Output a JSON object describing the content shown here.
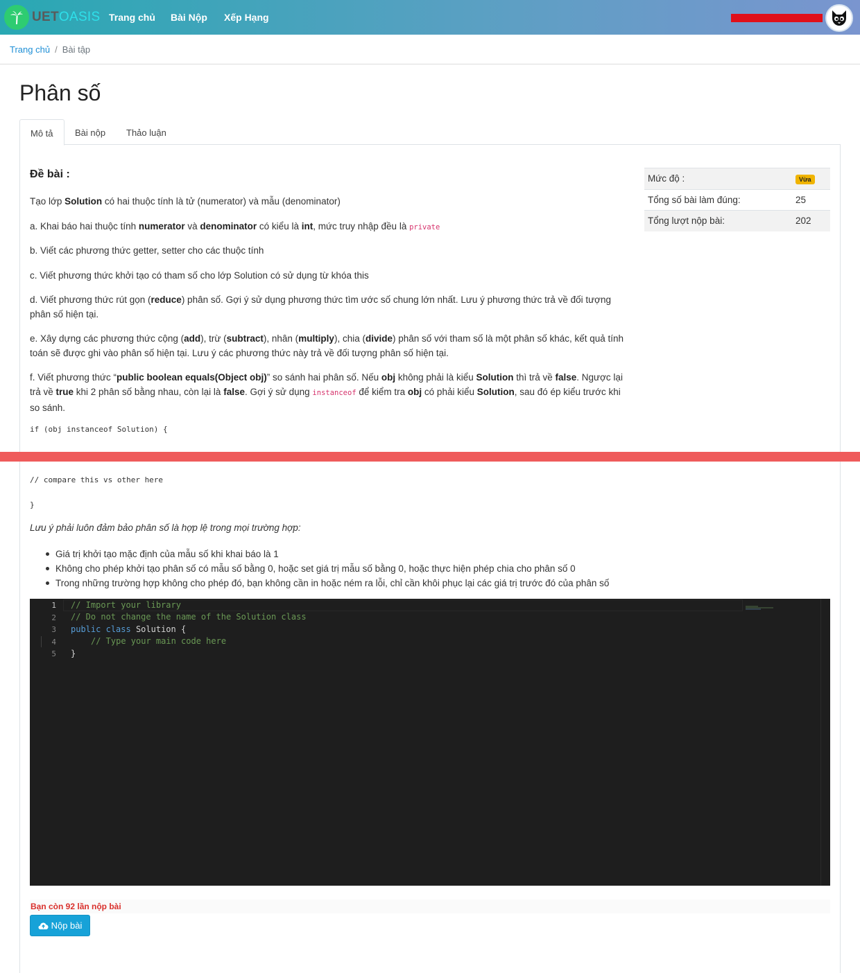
{
  "nav": {
    "logo_uet": "UET",
    "logo_oasis": "OASIS",
    "links": [
      "Trang chủ",
      "Bài Nộp",
      "Xếp Hạng"
    ]
  },
  "breadcrumb": {
    "home": "Trang chủ",
    "current": "Bài tập"
  },
  "title": "Phân số",
  "tabs": [
    "Mô tả",
    "Bài nộp",
    "Thảo luận"
  ],
  "problem": {
    "heading": "Đề bài :",
    "intro": [
      "Tạo lớp ",
      "Solution",
      " có hai thuộc tính là tử (numerator) và mẫu (denominator)"
    ],
    "a": [
      "a. Khai báo hai thuộc tính ",
      "numerator",
      " và ",
      "denominator",
      " có kiểu là ",
      "int",
      ", mức truy nhập đều là ",
      "private"
    ],
    "b": "b. Viết các phương thức getter, setter cho các thuộc tính",
    "c": "c. Viết phương thức khởi tạo có tham số cho lớp Solution có sử dụng từ khóa this",
    "d": [
      "d. Viết phương thức rút gọn (",
      "reduce",
      ") phân số. Gợi ý sử dụng phương thức tìm ước số chung lớn nhất. Lưu ý phương thức trả về đối tượng phân số hiện tại."
    ],
    "e": [
      "e. Xây dựng các phương thức cộng (",
      "add",
      "), trừ (",
      "subtract",
      "), nhân (",
      "multiply",
      "), chia (",
      "divide",
      ") phân số với tham số là một phân số khác, kết quả tính toán sẽ được ghi vào phân số hiện tại. Lưu ý các phương thức này trả về đối tượng phân số hiện tại."
    ],
    "f": [
      "f. Viết phương thức “",
      "public boolean equals(Object obj)",
      "” so sánh hai phân số. Nếu ",
      "obj",
      " không phải là kiểu ",
      "Solution",
      " thì trả về ",
      "false",
      ". Ngược lại trả về ",
      "true",
      " khi 2 phân số bằng nhau, còn lại là ",
      "false",
      ". Gợi ý sử dụng ",
      "instanceof",
      " để kiểm tra ",
      "obj",
      " có phải kiểu ",
      "Solution",
      ", sau đó ép kiểu trước khi so sánh."
    ],
    "code1": "if (obj instanceof Solution) {",
    "code2": "// compare this vs other here",
    "code3": "}",
    "note": "Lưu ý phải luôn đảm bảo phân số là hợp lệ trong mọi trường hợp:",
    "bullets": [
      "Giá trị khởi tạo mặc định của mẫu số khi khai báo là 1",
      "Không cho phép khởi tạo phân số có mẫu số bằng 0, hoặc set giá trị mẫu số bằng 0, hoặc thực hiện phép chia cho phân số 0",
      "Trong những trường hợp không cho phép đó, bạn không cần in hoặc ném ra lỗi, chỉ cần khôi phục lại các giá trị trước đó của phân số"
    ]
  },
  "info": {
    "level_label": "Mức độ :",
    "level_value": "Vừa",
    "correct_label": "Tổng số bài làm đúng:",
    "correct_value": "25",
    "submissions_label": "Tổng lượt nộp bài:",
    "submissions_value": "202"
  },
  "editor": {
    "line_numbers": [
      "1",
      "2",
      "3",
      "4",
      "5"
    ],
    "line1": "// Import your library",
    "line2": "// Do not change the name of the Solution class",
    "line3_kw1": "public",
    "line3_kw2": "class",
    "line3_rest": " Solution {",
    "line4": "// Type your main code here",
    "line5": "}"
  },
  "remaining_text": "Bạn còn 92 lần nộp bài",
  "submit_label": "Nộp bài",
  "colors": {
    "accent": "#17a2d8",
    "divider": "#ef5b5b",
    "badge": "#f0b400",
    "editor_bg": "#1e1e1e"
  }
}
